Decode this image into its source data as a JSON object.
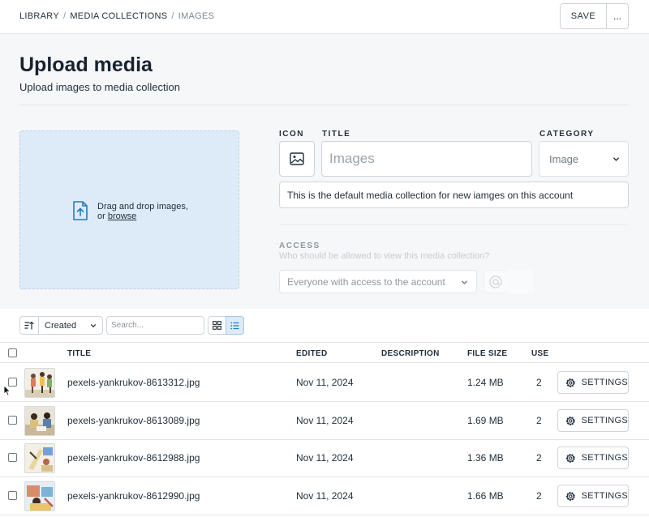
{
  "breadcrumb": {
    "items": [
      "LIBRARY",
      "MEDIA COLLECTIONS"
    ],
    "current": "IMAGES"
  },
  "header": {
    "save_label": "SAVE",
    "more_label": "..."
  },
  "page": {
    "title": "Upload media",
    "subtitle": "Upload images to media collection"
  },
  "dropzone": {
    "text": "Drag and drop images,",
    "or": "or",
    "browse": "browse"
  },
  "form": {
    "icon_label": "ICON",
    "title_label": "TITLE",
    "title_placeholder": "Images",
    "category_label": "CATEGORY",
    "category_value": "Image",
    "description_value": "This is the default media collection for new iamges on this account",
    "access_label": "ACCESS",
    "access_help": "Who should be allowed to view this media collection?",
    "access_value": "Everyone with access to the account"
  },
  "toolbar": {
    "sort_value": "Created",
    "search_placeholder": "Search..."
  },
  "table": {
    "headers": {
      "title": "TITLE",
      "edited": "EDITED",
      "description": "DESCRIPTION",
      "file_size": "FILE SIZE",
      "use": "USE"
    },
    "settings_label": "SETTINGS",
    "rows": [
      {
        "title": "pexels-yankrukov-8613312.jpg",
        "edited": "Nov 11, 2024",
        "description": "",
        "file_size": "1.24 MB",
        "use": "2"
      },
      {
        "title": "pexels-yankrukov-8613089.jpg",
        "edited": "Nov 11, 2024",
        "description": "",
        "file_size": "1.69 MB",
        "use": "2"
      },
      {
        "title": "pexels-yankrukov-8612988.jpg",
        "edited": "Nov 11, 2024",
        "description": "",
        "file_size": "1.36 MB",
        "use": "2"
      },
      {
        "title": "pexels-yankrukov-8612990.jpg",
        "edited": "Nov 11, 2024",
        "description": "",
        "file_size": "1.66 MB",
        "use": "2"
      }
    ]
  },
  "colors": {
    "accent": "#dcebf7",
    "accent_border": "#a8c7e3",
    "icon_blue": "#2a7ab8",
    "hero_bg": "#f6f7f9"
  }
}
